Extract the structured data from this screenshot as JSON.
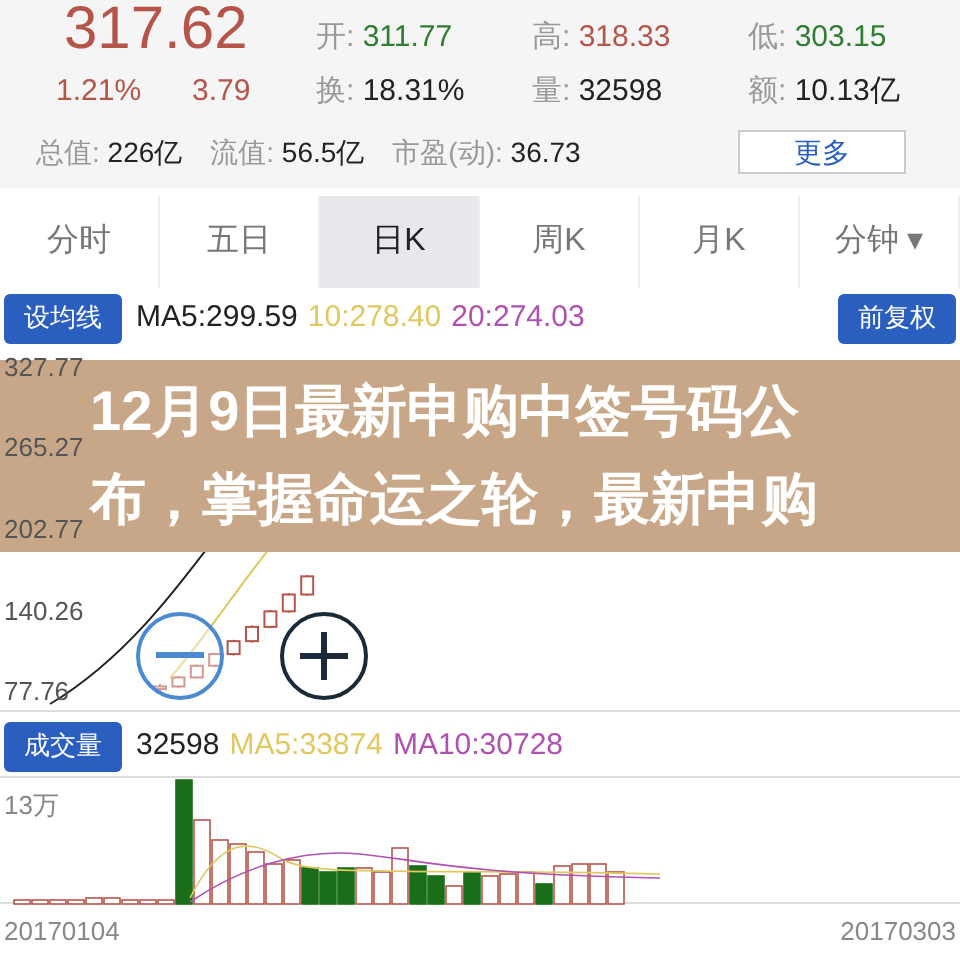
{
  "quote": {
    "price": "317.62",
    "change_pct": "1.21%",
    "change": "3.79"
  },
  "stats": [
    {
      "label": "开:",
      "value": "311.77",
      "kind": "down"
    },
    {
      "label": "高:",
      "value": "318.33",
      "kind": "up"
    },
    {
      "label": "低:",
      "value": "303.15",
      "kind": "down"
    },
    {
      "label": "换:",
      "value": "18.31%",
      "kind": "plain"
    },
    {
      "label": "量:",
      "value": "32598",
      "kind": "plain"
    },
    {
      "label": "额:",
      "value": "10.13亿",
      "kind": "plain"
    }
  ],
  "stats_row3": [
    {
      "label": "总值:",
      "value": "226亿"
    },
    {
      "label": "流值:",
      "value": "56.5亿"
    },
    {
      "label": "市盈(动):",
      "value": "36.73"
    }
  ],
  "more_button": "更多",
  "tabs": [
    {
      "label": "分时",
      "selected": false
    },
    {
      "label": "五日",
      "selected": false
    },
    {
      "label": "日K",
      "selected": true
    },
    {
      "label": "周K",
      "selected": false
    },
    {
      "label": "月K",
      "selected": false
    },
    {
      "label": "分钟 ▾",
      "selected": false
    }
  ],
  "ma_button": "设均线",
  "ma_values": [
    {
      "text": "MA5:299.59",
      "color": "#222222"
    },
    {
      "text": "10:278.40",
      "color": "#e0c860"
    },
    {
      "text": "20:274.03",
      "color": "#b050b0"
    }
  ],
  "adjust_button": "前复权",
  "price_chart": {
    "chart_data": {
      "type": "candlestick",
      "ohlc": [
        [
          80,
          84,
          78,
          82
        ],
        [
          82,
          90,
          81,
          89
        ],
        [
          89,
          99,
          88,
          98
        ],
        [
          98,
          108,
          97,
          107
        ],
        [
          107,
          118,
          106,
          117
        ],
        [
          117,
          129,
          116,
          128
        ],
        [
          128,
          141,
          127,
          140
        ],
        [
          140,
          154,
          139,
          153
        ],
        [
          153,
          168,
          152,
          167
        ]
      ],
      "ylim": [
        77.76,
        327.77
      ],
      "yticks": [
        {
          "value": 327.77,
          "label": "327.77"
        },
        {
          "value": 265.27,
          "label": "265.27"
        },
        {
          "value": 202.77,
          "label": "202.77"
        },
        {
          "value": 140.26,
          "label": "140.26"
        },
        {
          "value": 77.76,
          "label": "77.76"
        }
      ]
    }
  },
  "banner": {
    "title": "12月9日最新申购中签号码公布，掌握命运之轮，最新申购"
  },
  "volume_button": "成交量",
  "volume_values": [
    {
      "text": "32598",
      "color": "#222222"
    },
    {
      "text": "MA5:33874",
      "color": "#e0c860"
    },
    {
      "text": "MA10:30728",
      "color": "#b050b0"
    }
  ],
  "volume_axis": "13万",
  "dates": [
    "20170104",
    "20170303"
  ]
}
